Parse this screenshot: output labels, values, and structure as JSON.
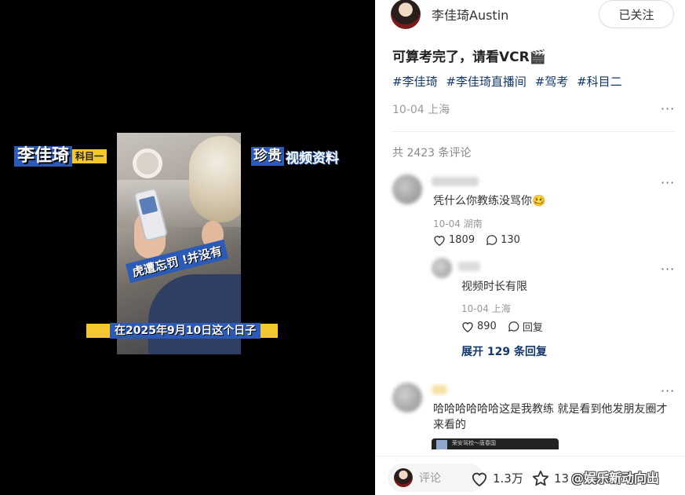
{
  "video": {
    "sticker_left_name": "李佳琦",
    "sticker_left_sub": "科目一",
    "sticker_right_a": "珍贵",
    "sticker_right_b": "视频资料",
    "caption_mid": "虎遭忘罚 !并没有",
    "caption_bottom": "在2025年9月10日这个日子"
  },
  "post": {
    "author_name": "李佳琦Austin",
    "follow_label": "已关注",
    "title": "可算考完了，请看VCR🎬",
    "tags": [
      "#李佳琦",
      "#李佳琦直播间",
      "#驾考",
      "#科目二"
    ],
    "meta": "10-04 上海",
    "comment_count_label": "共 2423 条评论"
  },
  "comments": [
    {
      "text": "凭什么你教练没骂你🥴",
      "meta": "10-04 湖南",
      "likes": "1809",
      "replies": "130",
      "sub_reply": {
        "text": "视频时长有限",
        "meta": "10-04 上海",
        "likes": "890",
        "reply_label": "回复"
      },
      "expand_label": "展开 129 条回复"
    },
    {
      "text": "哈哈哈哈哈哈这是我教练 就是看到他发朋友圈才来看的",
      "preview_label": "荣安驾校～唐春国"
    }
  ],
  "bottom": {
    "comment_placeholder": "评论",
    "likes": "1.3万",
    "favorites": "13",
    "watermark": "@娱乐新动向出"
  },
  "icons": {
    "more": "more-icon",
    "heart": "heart-icon",
    "comment": "comment-icon",
    "star": "star-icon"
  }
}
